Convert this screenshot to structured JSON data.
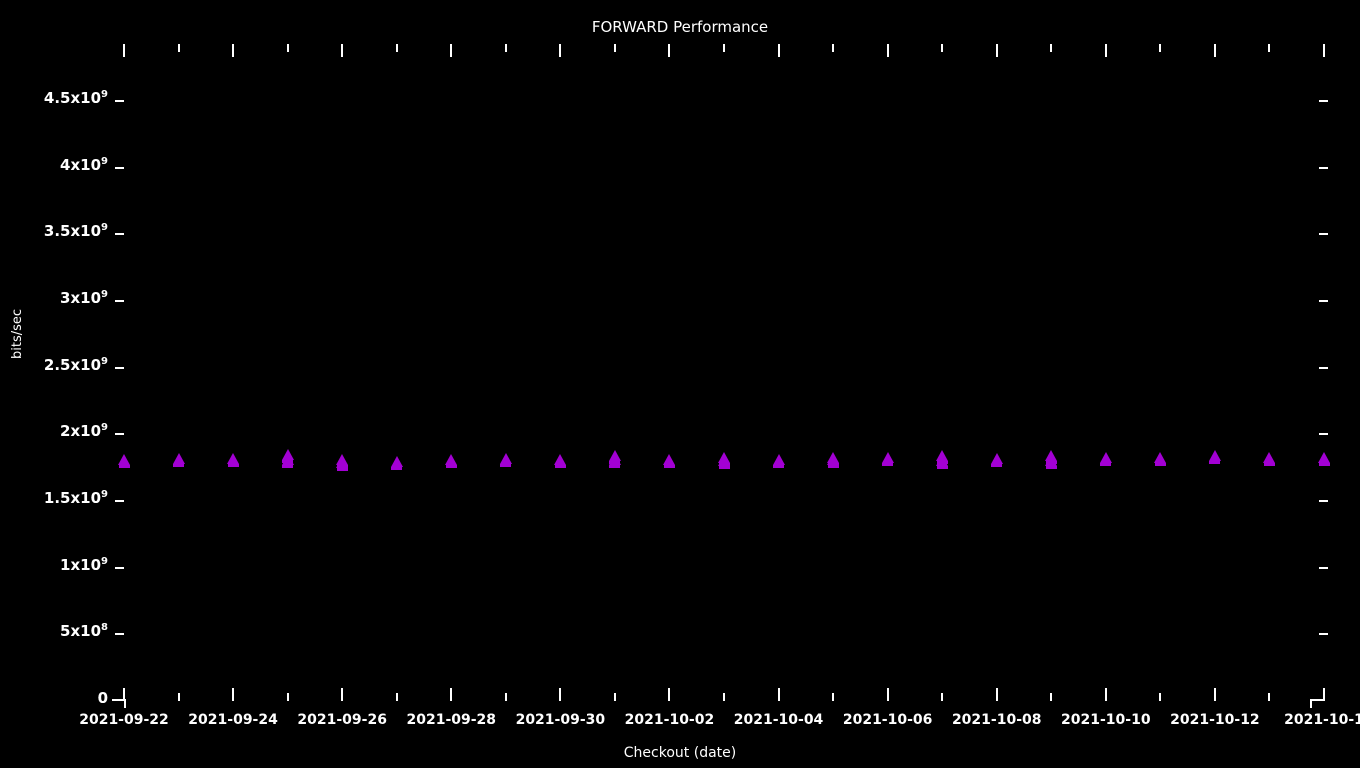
{
  "chart": {
    "title": "FORWARD Performance",
    "xlabel": "Checkout (date)",
    "ylabel": "bits/sec",
    "background_color": "#000000",
    "foreground_color": "#ffffff",
    "marker_color": "#a300d4"
  },
  "y_ticks": [
    {
      "label": "4.5x10",
      "exp": "9",
      "value": 4500000000
    },
    {
      "label": "4x10",
      "exp": "9",
      "value": 4000000000
    },
    {
      "label": "3.5x10",
      "exp": "9",
      "value": 3500000000
    },
    {
      "label": "3x10",
      "exp": "9",
      "value": 3000000000
    },
    {
      "label": "2.5x10",
      "exp": "9",
      "value": 2500000000
    },
    {
      "label": "2x10",
      "exp": "9",
      "value": 2000000000
    },
    {
      "label": "1.5x10",
      "exp": "9",
      "value": 1500000000
    },
    {
      "label": "1x10",
      "exp": "9",
      "value": 1000000000
    },
    {
      "label": "5x10",
      "exp": "8",
      "value": 500000000
    },
    {
      "label": "0",
      "exp": "",
      "value": 0
    }
  ],
  "x_ticks": [
    {
      "label": "2021-09-22"
    },
    {
      "label": "2021-09-24"
    },
    {
      "label": "2021-09-26"
    },
    {
      "label": "2021-09-28"
    },
    {
      "label": "2021-09-30"
    },
    {
      "label": "2021-10-02"
    },
    {
      "label": "2021-10-04"
    },
    {
      "label": "2021-10-06"
    },
    {
      "label": "2021-10-08"
    },
    {
      "label": "2021-10-10"
    },
    {
      "label": "2021-10-12"
    },
    {
      "label": "2021-10-1"
    }
  ],
  "chart_data": {
    "type": "scatter",
    "title": "FORWARD Performance",
    "xlabel": "Checkout (date)",
    "ylabel": "bits/sec",
    "xlim": [
      "2021-09-21",
      "2021-10-14"
    ],
    "ylim": [
      0,
      4800000000
    ],
    "grid": false,
    "legend": false,
    "marker": "triangle",
    "marker_color": "#a300d4",
    "series": [
      {
        "name": "FORWARD",
        "x": [
          "2021-09-22",
          "2021-09-23",
          "2021-09-24",
          "2021-09-25",
          "2021-09-26",
          "2021-09-27",
          "2021-09-28",
          "2021-09-29",
          "2021-09-30",
          "2021-10-01",
          "2021-10-02",
          "2021-10-03",
          "2021-10-04",
          "2021-10-05",
          "2021-10-06",
          "2021-10-07",
          "2021-10-08",
          "2021-10-09",
          "2021-10-10",
          "2021-10-11",
          "2021-10-12",
          "2021-10-13",
          "2021-10-14"
        ],
        "y": [
          1760000000,
          1770000000,
          1770000000,
          1800000000,
          1760000000,
          1750000000,
          1760000000,
          1770000000,
          1760000000,
          1790000000,
          1760000000,
          1780000000,
          1760000000,
          1780000000,
          1780000000,
          1790000000,
          1770000000,
          1790000000,
          1780000000,
          1780000000,
          1790000000,
          1780000000,
          1780000000
        ],
        "y_secondary": [
          null,
          null,
          null,
          1760000000,
          1740000000,
          null,
          null,
          null,
          null,
          1760000000,
          null,
          1755000000,
          null,
          1760000000,
          null,
          1755000000,
          null,
          1755000000,
          null,
          null,
          null,
          null,
          null
        ]
      }
    ]
  }
}
